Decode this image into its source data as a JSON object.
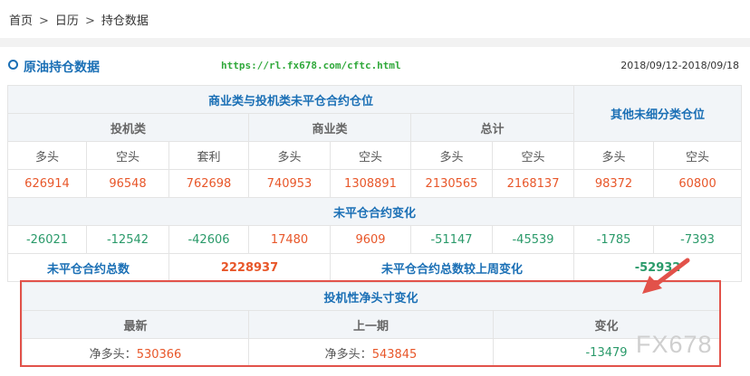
{
  "breadcrumb": {
    "items": [
      "首页",
      "日历",
      "持仓数据"
    ],
    "separator": ">"
  },
  "section": {
    "title": "原油持仓数据",
    "url": "https://rl.fx678.com/cftc.html",
    "date_range": "2018/09/12-2018/09/18"
  },
  "table": {
    "header_main": "商业类与投机类未平仓合约仓位",
    "header_other": "其他未细分类仓位",
    "groups": [
      "投机类",
      "商业类",
      "总计"
    ],
    "sub_headers": [
      "多头",
      "空头",
      "套利",
      "多头",
      "空头",
      "多头",
      "空头",
      "多头",
      "空头"
    ],
    "positions": [
      "626914",
      "96548",
      "762698",
      "740953",
      "1308891",
      "2130565",
      "2168137",
      "98372",
      "60800"
    ],
    "change_title": "未平仓合约变化",
    "changes": [
      "-26021",
      "-12542",
      "-42606",
      "17480",
      "9609",
      "-51147",
      "-45539",
      "-1785",
      "-7393"
    ],
    "total_label": "未平仓合约总数",
    "total_value": "2228937",
    "weekly_change_label": "未平仓合约总数较上周变化",
    "weekly_change_value": "-52932"
  },
  "spec": {
    "title": "投机性净头寸变化",
    "columns": [
      "最新",
      "上一期",
      "变化"
    ],
    "net_long_label": "净多头：",
    "latest": "530366",
    "previous": "543845",
    "change": "-13479"
  },
  "watermark": "FX678",
  "colors": {
    "blue": "#1a6fb5",
    "red": "#e8572a",
    "green": "#2a9a6a",
    "highlight": "#e2524a",
    "url": "#2fa83a"
  }
}
